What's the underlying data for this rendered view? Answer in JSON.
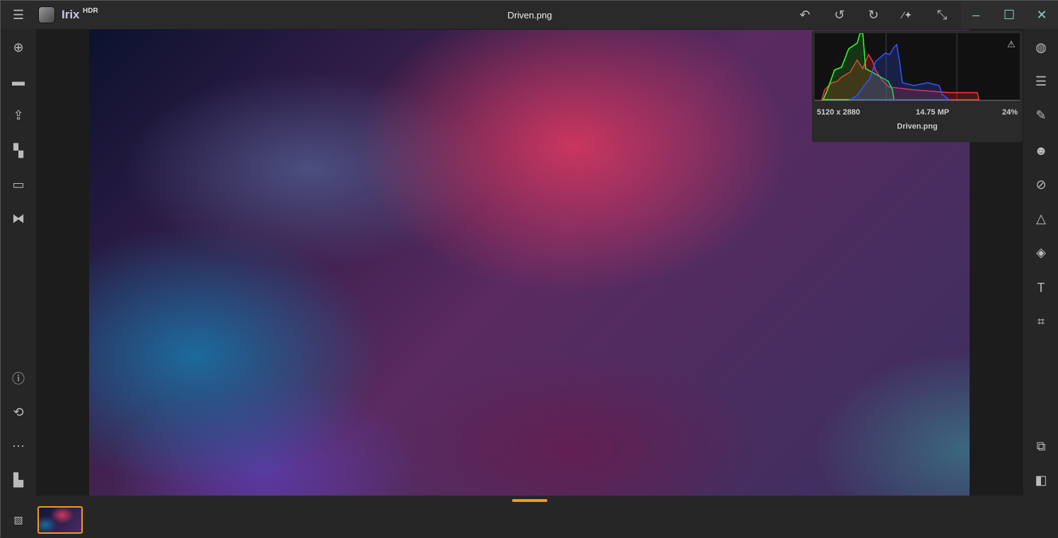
{
  "app": {
    "name": "Irix",
    "badge": "HDR",
    "file_title": "Driven.png"
  },
  "titlebar": {
    "icons": [
      "reply-all-icon",
      "undo-icon",
      "redo-icon",
      "ai-magic-wand-icon",
      "collapse-icon"
    ],
    "window": [
      "minimize-icon",
      "maximize-icon",
      "close-icon"
    ]
  },
  "left_sidebar": [
    "add-icon",
    "folder-icon",
    "export-icon",
    "batch-icon",
    "window-icon",
    "panorama-icon",
    "info-icon",
    "history-icon",
    "more-icon",
    "plugins-icon"
  ],
  "right_sidebar": [
    "color-icon",
    "adjustments-icon",
    "brush-icon",
    "face-icon",
    "healing-icon",
    "transform-icon",
    "layers-icon",
    "text-icon",
    "crop-icon",
    "stack-icon",
    "compare-icon"
  ],
  "histogram": {
    "dimensions": "5120 x 2880",
    "megapixels": "14.75 MP",
    "zoom": "24%",
    "filename": "Driven.png"
  }
}
